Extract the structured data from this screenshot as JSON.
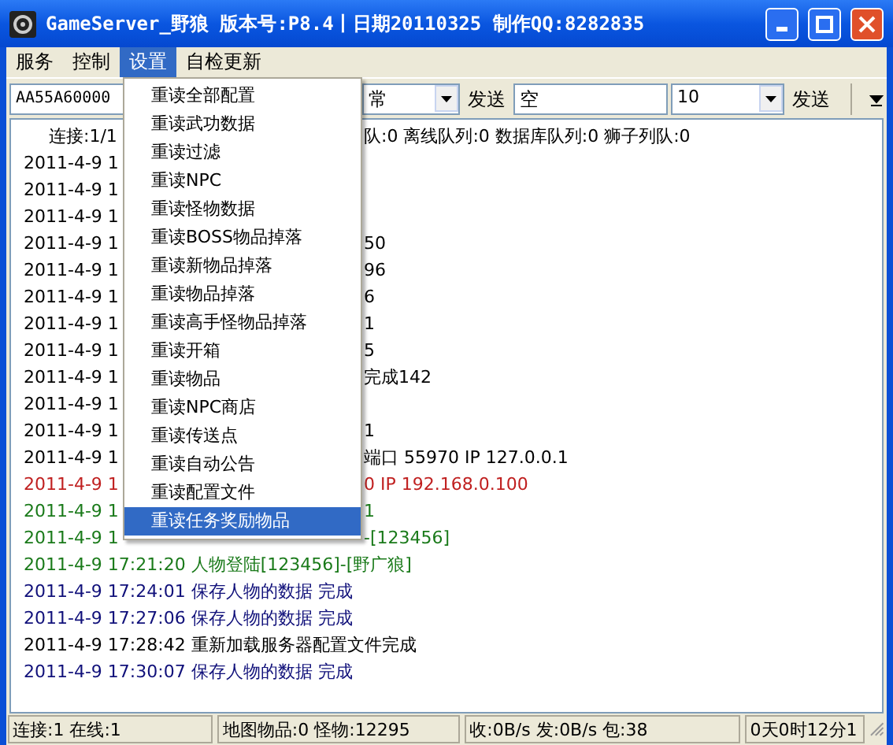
{
  "window": {
    "title": "GameServer_野狼 版本号:P8.4丨日期20110325 制作QQ:8282835"
  },
  "menubar": [
    {
      "label": "服务",
      "selected": false
    },
    {
      "label": "控制",
      "selected": false
    },
    {
      "label": "设置",
      "selected": true
    },
    {
      "label": "自检更新",
      "selected": false
    }
  ],
  "toolbar": {
    "command_field": "AA55A60000",
    "combo_1": "常",
    "send_button_1": "发送",
    "text_field": "空",
    "combo_2": "10",
    "send_button_2": "发送"
  },
  "log": [
    {
      "text": "连接:1/1",
      "tail": "队:0 离线队列:0 数据库队列:0 狮子列队:0",
      "color": "#000000",
      "indent": true
    },
    {
      "text": "2011-4-9 1",
      "color": "#000000"
    },
    {
      "text": "2011-4-9 1",
      "color": "#000000"
    },
    {
      "text": "2011-4-9 1",
      "color": "#000000"
    },
    {
      "text": "2011-4-9 1",
      "tail": "50",
      "color": "#000000"
    },
    {
      "text": "2011-4-9 1",
      "tail": "96",
      "color": "#000000"
    },
    {
      "text": "2011-4-9 1",
      "tail": "6",
      "color": "#000000"
    },
    {
      "text": "2011-4-9 1",
      "tail": "1",
      "color": "#000000"
    },
    {
      "text": "2011-4-9 1",
      "tail": "5",
      "color": "#000000"
    },
    {
      "text": "2011-4-9 1",
      "tail": "完成142",
      "color": "#000000"
    },
    {
      "text": "2011-4-9 1",
      "color": "#000000"
    },
    {
      "text": "2011-4-9 1",
      "tail": "1",
      "color": "#000000"
    },
    {
      "text": "2011-4-9 1",
      "tail": "端口 55970 IP 127.0.0.1",
      "color": "#000000"
    },
    {
      "text": "2011-4-9 1",
      "tail": "0 IP 192.168.0.100",
      "color": "#c02020"
    },
    {
      "text": "2011-4-9 1",
      "tail": "1",
      "color": "#1a7a1a"
    },
    {
      "text": "2011-4-9 1",
      "tail": "-[123456]",
      "color": "#1a7a1a"
    },
    {
      "text": "2011-4-9  17:21:20 人物登陆[123456]-[野广狼]",
      "color": "#1a7a1a"
    },
    {
      "text": "2011-4-9  17:24:01 保存人物的数据 完成",
      "color": "#10107a"
    },
    {
      "text": "2011-4-9  17:27:06 保存人物的数据 完成",
      "color": "#10107a"
    },
    {
      "text": "2011-4-9  17:28:42 重新加载服务器配置文件完成",
      "color": "#000000"
    },
    {
      "text": "2011-4-9  17:30:07 保存人物的数据 完成",
      "color": "#10107a"
    }
  ],
  "settings_menu": [
    {
      "label": "重读全部配置",
      "selected": false
    },
    {
      "label": "重读武功数据",
      "selected": false
    },
    {
      "label": "重读过滤",
      "selected": false
    },
    {
      "label": "重读NPC",
      "selected": false
    },
    {
      "label": "重读怪物数据",
      "selected": false
    },
    {
      "label": "重读BOSS物品掉落",
      "selected": false
    },
    {
      "label": "重读新物品掉落",
      "selected": false
    },
    {
      "label": "重读物品掉落",
      "selected": false
    },
    {
      "label": "重读高手怪物品掉落",
      "selected": false
    },
    {
      "label": "重读开箱",
      "selected": false
    },
    {
      "label": "重读物品",
      "selected": false
    },
    {
      "label": "重读NPC商店",
      "selected": false
    },
    {
      "label": "重读传送点",
      "selected": false
    },
    {
      "label": "重读自动公告",
      "selected": false
    },
    {
      "label": "重读配置文件",
      "selected": false
    },
    {
      "label": "重读任务奖励物品",
      "selected": true
    }
  ],
  "status_bar": [
    "连接:1 在线:1",
    "地图物品:0 怪物:12295",
    "收:0B/s 发:0B/s 包:38",
    "0天0时12分1"
  ]
}
